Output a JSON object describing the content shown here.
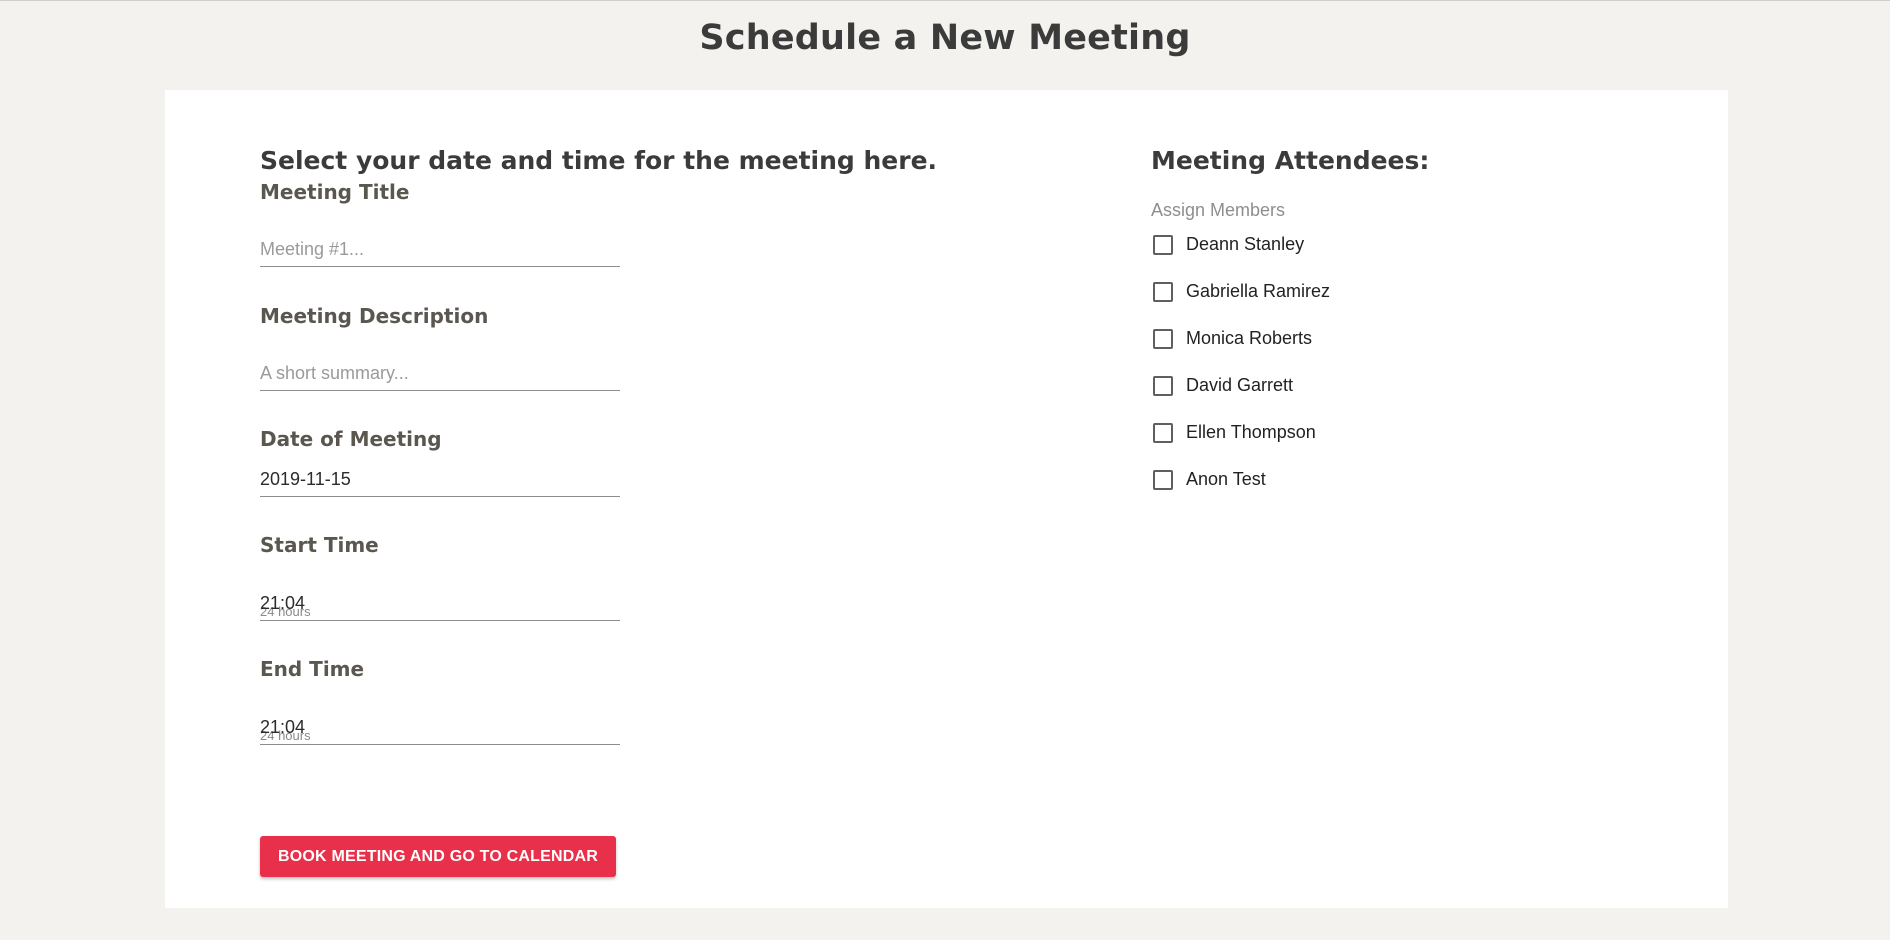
{
  "page": {
    "title": "Schedule a New Meeting"
  },
  "form": {
    "heading": "Select your date and time for the meeting here.",
    "meeting_title": {
      "label": "Meeting Title",
      "value": "",
      "placeholder": "Meeting #1..."
    },
    "meeting_description": {
      "label": "Meeting Description",
      "value": "",
      "placeholder": "A short summary..."
    },
    "date": {
      "label": "Date of Meeting",
      "value": "2019-11-15"
    },
    "start_time": {
      "label": "Start Time",
      "helper": "24 hours",
      "value": "21:04"
    },
    "end_time": {
      "label": "End Time",
      "helper": "24 hours",
      "value": "21:04"
    },
    "submit_label": "BOOK MEETING AND GO TO CALENDAR"
  },
  "attendees": {
    "heading": "Meeting Attendees:",
    "assign_label": "Assign Members",
    "members": [
      {
        "name": "Deann Stanley",
        "checked": false
      },
      {
        "name": "Gabriella Ramirez",
        "checked": false
      },
      {
        "name": "Monica Roberts",
        "checked": false
      },
      {
        "name": "David Garrett",
        "checked": false
      },
      {
        "name": "Ellen Thompson",
        "checked": false
      },
      {
        "name": "Anon Test",
        "checked": false
      }
    ]
  },
  "colors": {
    "background": "#f3f2ef",
    "card": "#ffffff",
    "accent": "#e8304a",
    "heading": "#3b3b3b",
    "label": "#5a5650"
  },
  "icons": {
    "checkbox": "checkbox-unchecked-icon"
  }
}
